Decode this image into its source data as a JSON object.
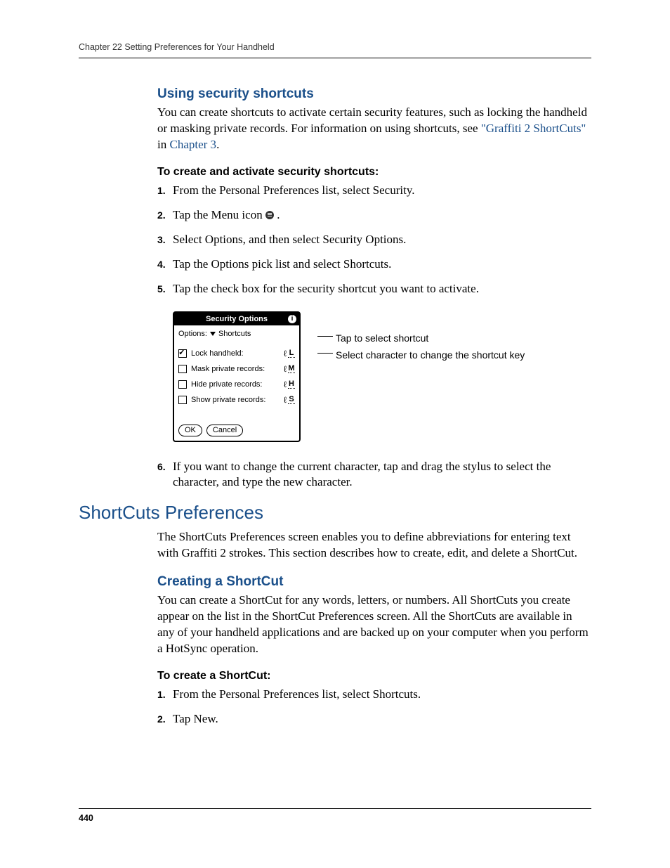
{
  "header": {
    "chapter_line": "Chapter 22    Setting Preferences for Your Handheld"
  },
  "sec1": {
    "heading": "Using security shortcuts",
    "intro_before_link": "You can create shortcuts to activate certain security features, such as locking the handheld or masking private records. For information on using shortcuts, see ",
    "link1": "\"Graffiti 2 ShortCuts\"",
    "intro_mid": " in ",
    "link2": "Chapter 3",
    "intro_after": ".",
    "task_heading": "To create and activate security shortcuts:",
    "steps": {
      "s1": "From the Personal Preferences list, select Security.",
      "s2a": "Tap the Menu icon ",
      "s2b": ".",
      "s3": "Select Options, and then select Security Options.",
      "s4": "Tap the Options pick list and select Shortcuts.",
      "s5": "Tap the check box for the security shortcut you want to activate.",
      "s6": "If you want to change the current character, tap and drag the stylus to select the character, and type the new character."
    }
  },
  "device": {
    "title": "Security Options",
    "options_label": "Options:",
    "options_value": "Shortcuts",
    "rows": [
      {
        "label": "Lock handheld:",
        "key": "L",
        "checked": true
      },
      {
        "label": "Mask private records:",
        "key": "M",
        "checked": false
      },
      {
        "label": "Hide private records:",
        "key": "H",
        "checked": false
      },
      {
        "label": "Show private records:",
        "key": "S",
        "checked": false
      }
    ],
    "ok": "OK",
    "cancel": "Cancel"
  },
  "callouts": {
    "c1": "Tap to select shortcut",
    "c2": "Select character to change the shortcut key"
  },
  "sec2": {
    "heading": "ShortCuts Preferences",
    "intro": "The ShortCuts Preferences screen enables you to define abbreviations for entering text with Graffiti 2 strokes. This section describes how to create, edit, and delete a ShortCut.",
    "sub_heading": "Creating a ShortCut",
    "sub_intro": "You can create a ShortCut for any words, letters, or numbers. All ShortCuts you create appear on the list in the ShortCut Preferences screen. All the ShortCuts are available in any of your handheld applications and are backed up on your computer when you perform a HotSync operation.",
    "task_heading": "To create a ShortCut:",
    "steps": {
      "s1": "From the Personal Preferences list, select Shortcuts.",
      "s2": "Tap New."
    }
  },
  "footer": {
    "page_num": "440"
  },
  "nums": {
    "n1": "1.",
    "n2": "2.",
    "n3": "3.",
    "n4": "4.",
    "n5": "5.",
    "n6": "6."
  }
}
